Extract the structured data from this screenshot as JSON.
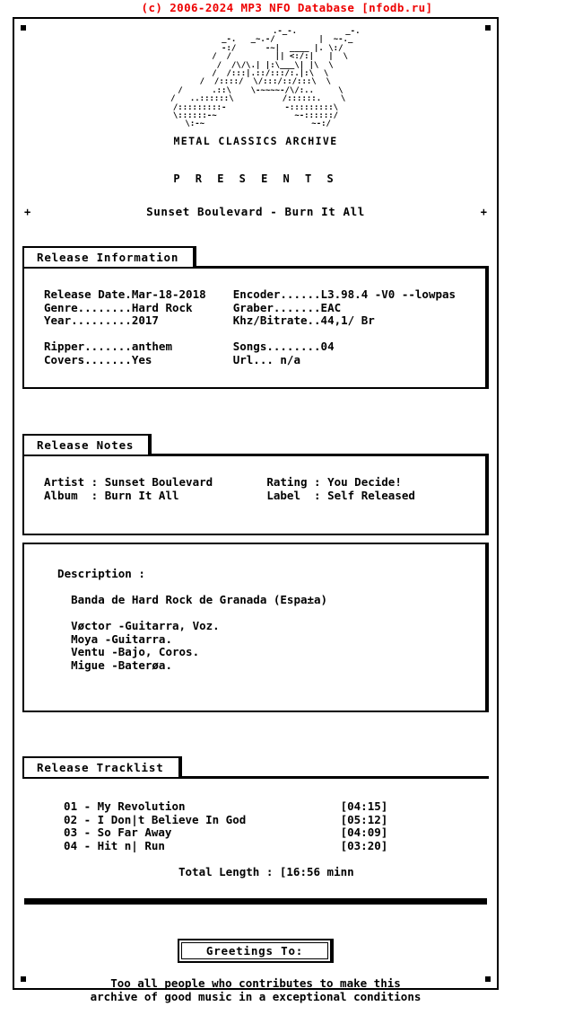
{
  "site_header": "(c) 2006-2024 MP3 NFO Database [nfodb.ru]",
  "logo": {
    "ascii_art": "                         .-_-.          _-.\n             _-.   _~.-/         |  ~-._\n           -:/      -~|  ____ |. \\:/\n          /  /         || <:/:|   |  \\\n        /  /\\/\\.| |:\\___\\| |\\  \\\n      /  /:::|.::/:::/:.|:\\  \\\n    /  /::::/  \\/:::/::/:::\\  \\\n  /      .::\\    \\-~~~~-/\\/:..     \\\n /   ..::::::\\          /::::::.    \\\n/:::::::::-            -:::::::::\\\n\\::::::-~                ~-::::::/\n \\:-~                      ~-:/",
    "caption": "METAL CLASSICS ARCHIVE"
  },
  "presents": "P R E S E N T S",
  "release_title": "Sunset Boulevard - Burn It All",
  "corner_marker": "+",
  "sections": {
    "release_information": {
      "tab_label": "Release Information",
      "body": "Release Date.Mar-18-2018    Encoder......L3.98.4 -V0 --lowpas\nGenre........Hard Rock      Graber.......EAC\nYear.........2017           Khz/Bitrate..44,1/ Br\n\nRipper.......anthem         Songs........04\nCovers.......Yes            Url... n/a"
    },
    "release_notes": {
      "tab_label": "Release Notes",
      "body": "Artist : Sunset Boulevard        Rating : You Decide!\nAlbum  : Burn It All             Label  : Self Released"
    },
    "description": {
      "body": "  Description :\n\n    Banda de Hard Rock de Granada (Espa±a)\n\n    Vøctor -Guitarra, Voz.\n    Moya -Guitarra.\n    Ventu -Bajo, Coros.\n    Migue -Baterøa."
    },
    "release_tracklist": {
      "tab_label": "Release Tracklist",
      "body": "  01 - My Revolution                       [04:15]\n  02 - I Don|t Believe In God              [05:12]\n  03 - So Far Away                         [04:09]\n  04 - Hit n| Run                          [03:20]\n\n                   Total Length : [16:56 minn"
    },
    "greetings": {
      "box_label": "Greetings To:",
      "text": "Too all people who contributes to make this\narchive of good music in a exceptional conditions"
    }
  },
  "colors": {
    "header_red": "#ee0000",
    "ink": "#000000",
    "paper": "#ffffff"
  }
}
